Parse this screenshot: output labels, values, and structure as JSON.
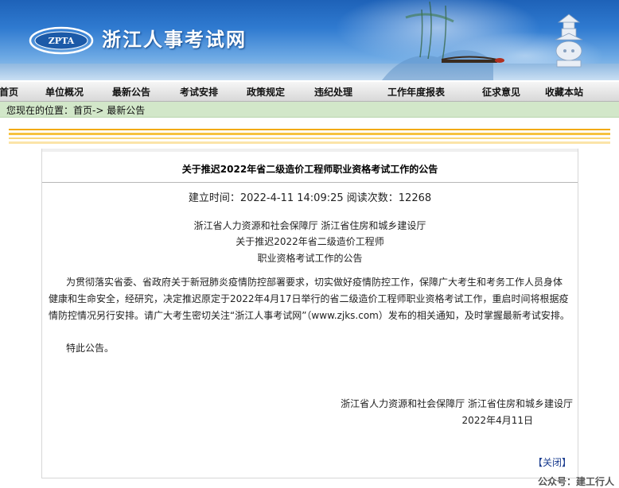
{
  "header": {
    "logo_text": "ZPTA",
    "site_title": "浙江人事考试网"
  },
  "nav": {
    "items": [
      "首页",
      "单位概况",
      "最新公告",
      "考试安排",
      "政策规定",
      "违纪处理",
      "工作年度报表",
      "征求意见",
      "收藏本站"
    ]
  },
  "breadcrumb": {
    "text": "您现在的位置：首页-> 最新公告"
  },
  "article": {
    "title": "关于推迟2022年省二级造价工程师职业资格考试工作的公告",
    "meta": "建立时间：2022-4-11 14:09:25 阅读次数：12268",
    "header_lines": [
      "浙江省人力资源和社会保障厅 浙江省住房和城乡建设厅",
      "关于推迟2022年省二级造价工程师",
      "职业资格考试工作的公告"
    ],
    "body": "为贯彻落实省委、省政府关于新冠肺炎疫情防控部署要求，切实做好疫情防控工作，保障广大考生和考务工作人员身体健康和生命安全，经研究，决定推迟原定于2022年4月17日举行的省二级造价工程师职业资格考试工作，重启时间将根据疫情防控情况另行安排。请广大考生密切关注“浙江人事考试网”（www.zjks.com）发布的相关通知，及时掌握最新考试安排。",
    "closing": "特此公告。",
    "signature": "浙江省人力资源和社会保障厅 浙江省住房和城乡建设厅",
    "date": "2022年4月11日",
    "close_label": "【关闭】"
  },
  "watermark": "公众号：建工行人"
}
